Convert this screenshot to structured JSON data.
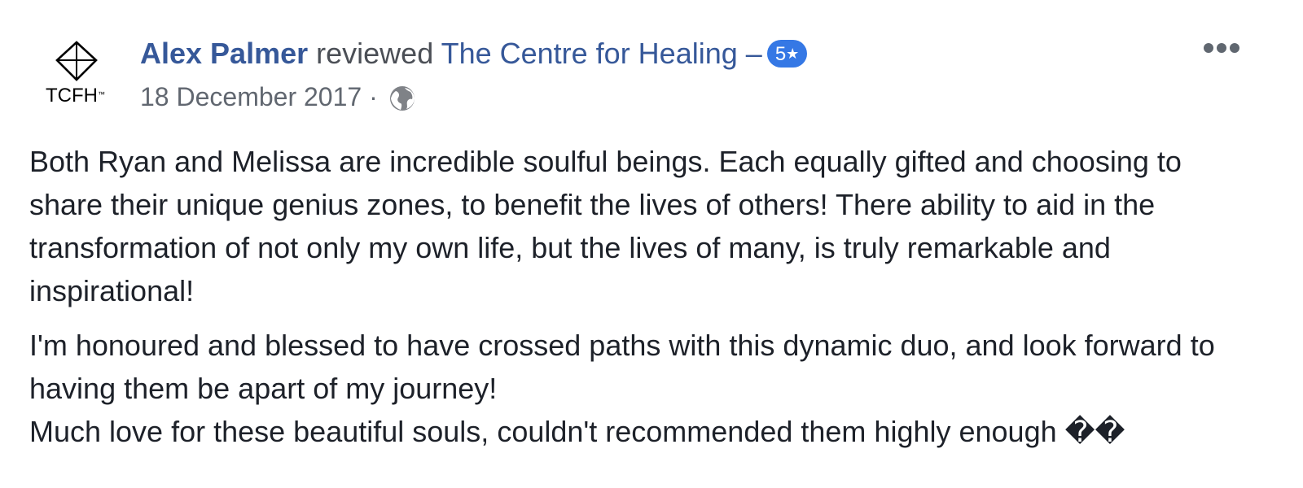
{
  "post": {
    "avatar": {
      "logo_text": "TCFH",
      "logo_mark": "™",
      "icon": "diamond-logo-icon"
    },
    "author_name": "Alex Palmer",
    "action_text": "reviewed",
    "page_name": "The Centre for Healing",
    "separator": "–",
    "rating_value": "5",
    "rating_icon": "★",
    "date": "18 December 2017",
    "meta_separator": "·",
    "privacy_icon": "globe-icon",
    "more_icon": "more-options-icon",
    "colors": {
      "link": "#365899",
      "badge": "#3578e5",
      "text": "#1d2129",
      "meta": "#616770"
    },
    "body": {
      "para1": "Both Ryan and Melissa are incredible soulful beings. Each equally gifted and choosing to share their unique genius zones, to benefit the lives of others! There ability to aid in the transformation of not only my own life, but the lives of many, is truly remarkable and inspirational!",
      "para2_line1": "I'm honoured and blessed to have crossed paths with this dynamic duo, and look forward to having them be apart of my journey!",
      "para2_line2": "Much love for these beautiful souls, couldn't recommended them highly enough ��"
    }
  }
}
